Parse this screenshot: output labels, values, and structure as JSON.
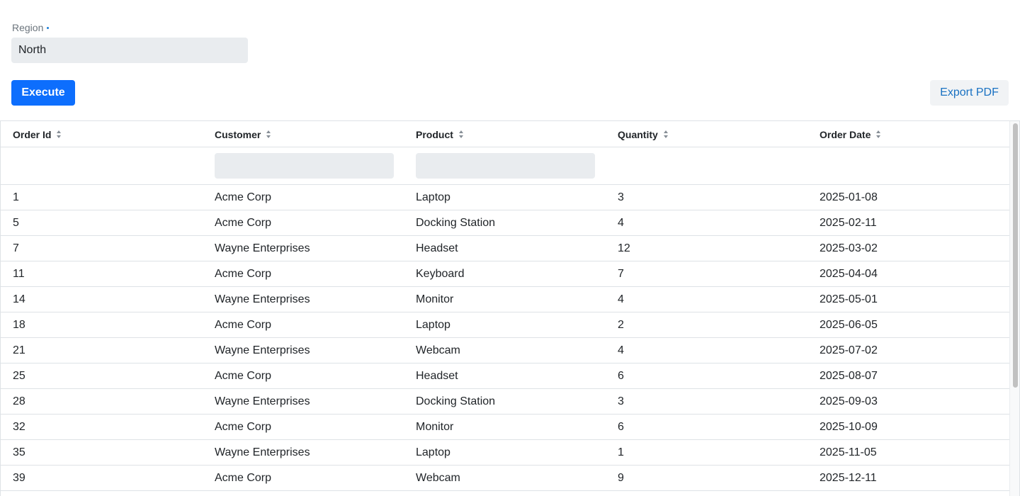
{
  "form": {
    "region_label": "Region",
    "region_value": "North",
    "execute_label": "Execute",
    "export_label": "Export PDF"
  },
  "table": {
    "columns": [
      "Order Id",
      "Customer",
      "Product",
      "Quantity",
      "Order Date"
    ],
    "rows": [
      [
        "1",
        "Acme Corp",
        "Laptop",
        "3",
        "2025-01-08"
      ],
      [
        "5",
        "Acme Corp",
        "Docking Station",
        "4",
        "2025-02-11"
      ],
      [
        "7",
        "Wayne Enterprises",
        "Headset",
        "12",
        "2025-03-02"
      ],
      [
        "11",
        "Acme Corp",
        "Keyboard",
        "7",
        "2025-04-04"
      ],
      [
        "14",
        "Wayne Enterprises",
        "Monitor",
        "4",
        "2025-05-01"
      ],
      [
        "18",
        "Acme Corp",
        "Laptop",
        "2",
        "2025-06-05"
      ],
      [
        "21",
        "Wayne Enterprises",
        "Webcam",
        "4",
        "2025-07-02"
      ],
      [
        "25",
        "Acme Corp",
        "Headset",
        "6",
        "2025-08-07"
      ],
      [
        "28",
        "Wayne Enterprises",
        "Docking Station",
        "3",
        "2025-09-03"
      ],
      [
        "32",
        "Acme Corp",
        "Monitor",
        "6",
        "2025-10-09"
      ],
      [
        "35",
        "Wayne Enterprises",
        "Laptop",
        "1",
        "2025-11-05"
      ],
      [
        "39",
        "Acme Corp",
        "Webcam",
        "9",
        "2025-12-11"
      ]
    ]
  },
  "colors": {
    "primary": "#0d6efd",
    "export_text": "#1971c2",
    "input_bg": "#e9ecef",
    "border": "#dee2e6"
  },
  "icons": {
    "sort": "sort-icon",
    "required": "required-dot-icon"
  }
}
